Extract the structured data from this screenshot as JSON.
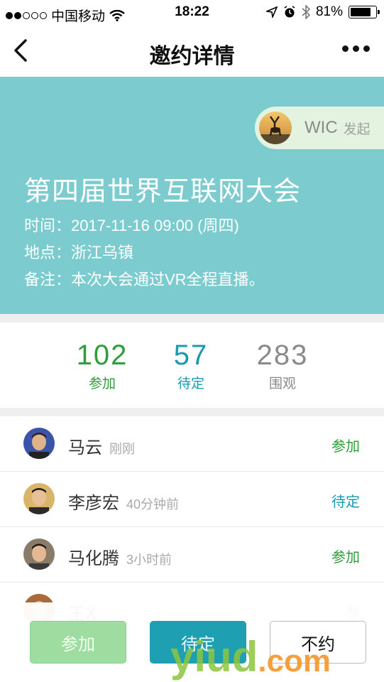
{
  "status_bar": {
    "carrier": "中国移动",
    "time": "18:22",
    "battery": "81%",
    "battery_level": 0.81
  },
  "nav": {
    "title": "邀约详情"
  },
  "hero": {
    "sponsor_name": "WIC",
    "sponsor_tag": "发起",
    "event_title": "第四届世界互联网大会",
    "time_line": "时间：2017-11-16 09:00 (周四)",
    "place_line": "地点：浙江乌镇",
    "note_line": "备注：本次大会通过VR全程直播。"
  },
  "stats": {
    "joined": {
      "value": "102",
      "label": "参加",
      "color": "#2e9d3a"
    },
    "pending": {
      "value": "57",
      "label": "待定",
      "color": "#1a9ab0"
    },
    "watching": {
      "value": "283",
      "label": "围观",
      "color": "#8a8a8a"
    }
  },
  "attendees": [
    {
      "name": "马云",
      "time": "刚刚",
      "status": "参加",
      "status_color": "#2e9d3a"
    },
    {
      "name": "李彦宏",
      "time": "40分钟前",
      "status": "待定",
      "status_color": "#1a9ab0"
    },
    {
      "name": "马化腾",
      "time": "3小时前",
      "status": "参加",
      "status_color": "#2e9d3a"
    },
    {
      "name": "王Ⅹ",
      "time": "…",
      "status": "参",
      "status_color": "#2e9d3a"
    }
  ],
  "actions": {
    "join": "参加",
    "pending": "待定",
    "decline": "不约"
  },
  "watermark": {
    "brand": "yiud",
    "suffix": ".com"
  }
}
